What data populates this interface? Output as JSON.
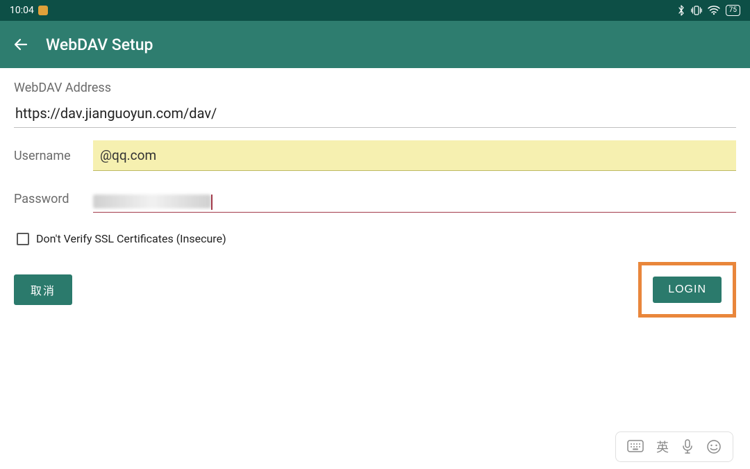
{
  "status_bar": {
    "time": "10:04",
    "battery_text": "75"
  },
  "app_bar": {
    "title": "WebDAV Setup"
  },
  "form": {
    "address_label": "WebDAV Address",
    "address_value": "https://dav.jianguoyun.com/dav/",
    "username_label": "Username",
    "username_value": "@qq.com",
    "password_label": "Password",
    "password_value": "",
    "ssl_checkbox_label": "Don't Verify SSL Certificates (Insecure)",
    "ssl_checked": false
  },
  "buttons": {
    "cancel_label": "取消",
    "login_label": "LOGIN"
  },
  "ime": {
    "lang_label": "英"
  }
}
